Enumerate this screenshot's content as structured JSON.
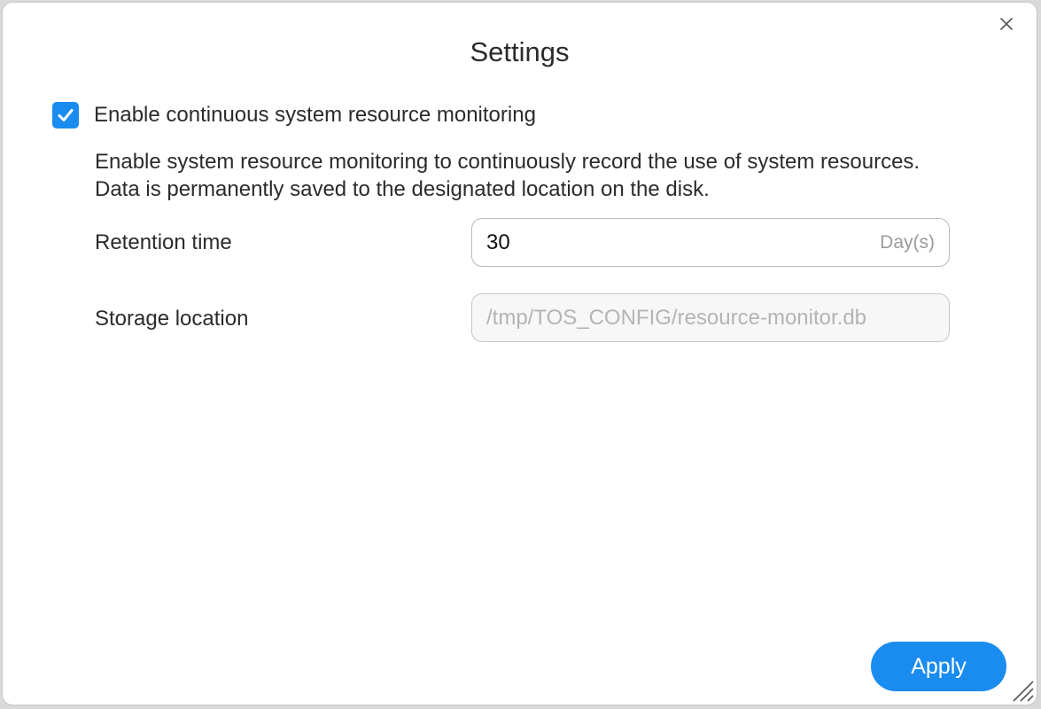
{
  "dialog": {
    "title": "Settings"
  },
  "monitoring": {
    "checkbox_label": "Enable continuous system resource monitoring",
    "checked": true,
    "description": "Enable system resource monitoring to continuously record the use of system resources. Data is permanently saved to the designated location on the disk."
  },
  "retention": {
    "label": "Retention time",
    "value": "30",
    "unit": "Day(s)"
  },
  "storage": {
    "label": "Storage location",
    "value": "/tmp/TOS_CONFIG/resource-monitor.db"
  },
  "actions": {
    "apply_label": "Apply"
  },
  "colors": {
    "accent": "#1a8cf0",
    "text": "#2b2b2b",
    "muted": "#9a9a9a"
  },
  "icons": {
    "close": "close-icon",
    "check": "checkmark-icon",
    "resize": "resize-grip-icon"
  }
}
